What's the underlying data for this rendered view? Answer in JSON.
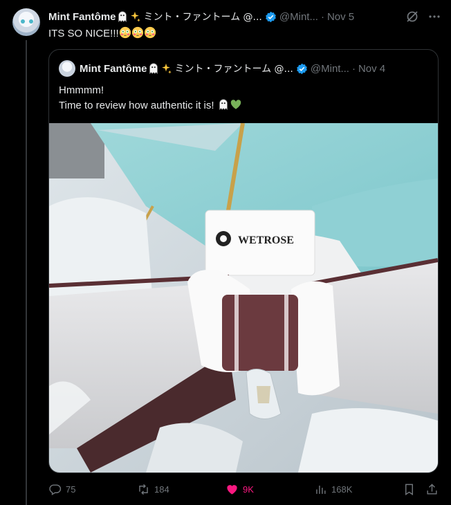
{
  "tweet": {
    "author_name": "Mint Fantôme",
    "author_extra": "ミント・ファントーム @...",
    "handle": "@Mint...",
    "date": "Nov 5",
    "text": "ITS SO NICE!!!"
  },
  "quoted": {
    "author_name": "Mint Fantôme",
    "author_extra": "ミント・ファントーム @...",
    "handle": "@Mint...",
    "date": "Nov 4",
    "line1": "Hmmmm!",
    "line2": "Time to review how authentic it is!",
    "image": {
      "tag_brand": "WETROSE"
    }
  },
  "actions": {
    "replies": "75",
    "reposts": "184",
    "likes": "9K",
    "views": "168K"
  },
  "colors": {
    "verified": "#1d9bf0",
    "like": "#f91880",
    "muted": "#71767b"
  }
}
